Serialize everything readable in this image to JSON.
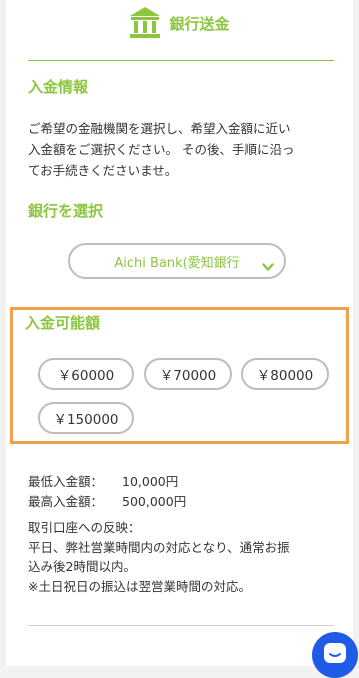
{
  "header": {
    "icon": "bank-icon",
    "title": "銀行送金"
  },
  "deposit_info": {
    "title": "入金情報",
    "lines": [
      "ご希望の金融機関を選択し、希望入金額に近い",
      "入金額をご選択ください。 その後、手順に沿っ",
      "てお手続きくださいませ。"
    ]
  },
  "bank_select": {
    "title": "銀行を選択",
    "value": "Aichi Bank(愛知銀行",
    "icon": "chevron-down-icon"
  },
  "amounts": {
    "title": "入金可能額",
    "options": [
      "￥60000",
      "￥70000",
      "￥80000",
      "￥150000"
    ]
  },
  "limits": {
    "min_label": "最低入金額：",
    "min_value": "10,000円",
    "max_label": "最高入金額：",
    "max_value": "500,000円"
  },
  "reflection": {
    "lines": [
      "取引口座への反映：",
      "平日、弊社営業時間内の対応となり、通常お振",
      "込み後2時間以内。",
      "※土日祝日の振込は翌営業時間の対応。"
    ]
  },
  "chat": {
    "icon": "chat-icon",
    "color": "#1e5be6"
  },
  "colors": {
    "accent": "#8cc63f",
    "highlight_border": "#f0a04b"
  }
}
